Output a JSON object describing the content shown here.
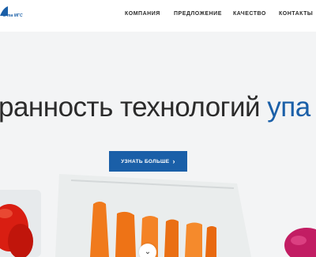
{
  "header": {
    "logo_text": "м та МГС",
    "nav": [
      {
        "label": "КОМПАНИЯ"
      },
      {
        "label": "ПРЕДЛОЖЕНИЕ"
      },
      {
        "label": "КАЧЕСТВО"
      },
      {
        "label": "КОНТАКТЫ"
      }
    ]
  },
  "hero": {
    "headline_main": "ранность технологий ",
    "headline_accent": "упа",
    "cta_label": "УЗНАТЬ БОЛЬШЕ",
    "cta_icon": "›",
    "scroll_icon": "⌄"
  },
  "colors": {
    "accent": "#1a5fa8",
    "text": "#2b2b2b",
    "background": "#f3f4f5"
  }
}
